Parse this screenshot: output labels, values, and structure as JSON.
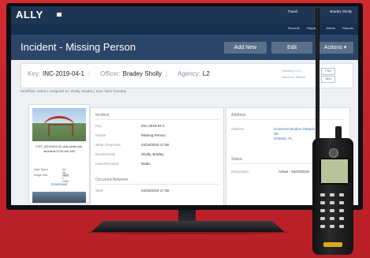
{
  "nav": {
    "logo": "ALLY",
    "user_links": [
      "Travel",
      "Bradey Sholly"
    ]
  },
  "subnav": {
    "links": [
      "Records",
      "Dispatch",
      "Admin",
      "Reports"
    ]
  },
  "header": {
    "title": "Incident - Missing Person",
    "buttons": {
      "add_new": "Add New",
      "edit": "Edit",
      "actions": "Actions"
    }
  },
  "infobar": {
    "key_label": "Key:",
    "key_value": "INC-2019-04-1",
    "officer_label": "Officer:",
    "officer_value": "Bradey Sholly",
    "agency_label": "Agency:",
    "agency_value": "L2",
    "viewing": "Viewing 1 of 1",
    "return_link": "Return to Search",
    "prev": "Prev",
    "next": "Next"
  },
  "workflow": {
    "label": "Workflow:",
    "status": "Active",
    "assigned": "Assigned To: Sholly, Bradey",
    "due": "Due: Next Tuesday"
  },
  "attachment": {
    "caption": "1707_N210404-01-ohio-state-fair-accident-0726-full-169",
    "meta": [
      {
        "label": "Date Taken",
        "value": "04-06-2019"
      },
      {
        "label": "Image Size",
        "value": "1920 x 1080"
      }
    ],
    "download": "Download"
  },
  "incident": {
    "section_title": "Incident",
    "rows": [
      {
        "label": "Key",
        "value": "INC-2019-04-1"
      },
      {
        "label": "Nature",
        "value": "Missing Person"
      },
      {
        "label": "When Reported",
        "value": "04/10/2019 17:38"
      },
      {
        "label": "Received By",
        "value": "Sholly, Bradey"
      },
      {
        "label": "How Received",
        "value": "Radio"
      }
    ],
    "second_section": "Occurred Between",
    "second_row_label": "Start",
    "second_row_value": "04/10/2019 17:38"
  },
  "address": {
    "section_title": "Address",
    "label": "Address",
    "lines": [
      "Universal Studios Orlando",
      "3D",
      "Orlando, FL"
    ]
  },
  "status": {
    "section_title": "Status",
    "label": "Disposition",
    "value": "Active - 04/10/2019"
  },
  "colors": {
    "background": "#c8242a",
    "nav": "#1f3554",
    "header": "#2b4568",
    "link": "#3a6fb0"
  }
}
